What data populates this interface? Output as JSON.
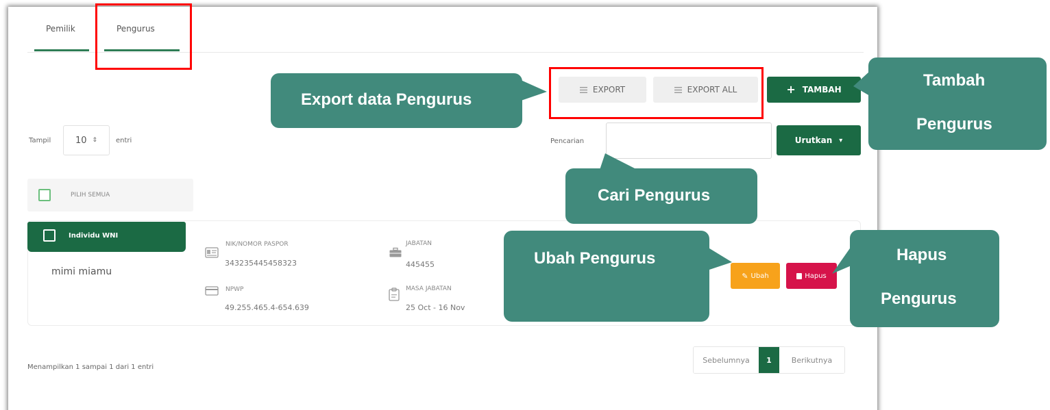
{
  "tabs": [
    {
      "label": "Pemilik"
    },
    {
      "label": "Pengurus"
    }
  ],
  "toolbar": {
    "export_label": "EXPORT",
    "export_all_label": "EXPORT ALL",
    "tambah_label": "TAMBAH",
    "list_icon": "list-icon",
    "plus_icon": "plus-icon"
  },
  "filter": {
    "show_label": "Tampil",
    "show_value": "10",
    "entries_label": "entri",
    "search_label": "Pencarian",
    "search_value": "",
    "sort_label": "Urutkan",
    "sort_icon": "caret-down-icon"
  },
  "select_all": {
    "label": "PILIH SEMUA"
  },
  "record": {
    "type_badge": "Individu WNI",
    "name": "mimi miamu",
    "nik_label": "NIK/NOMOR PASPOR",
    "nik_value": "343235445458323",
    "npwp_label": "NPWP",
    "npwp_value": "49.255.465.4-654.639",
    "jabatan_label": "JABATAN",
    "jabatan_value": "445455",
    "masa_label": "MASA JABATAN",
    "masa_value": "25 Oct - 16 Nov",
    "ubah_label": "Ubah",
    "hapus_label": "Hapus"
  },
  "footer": {
    "info": "Menampilkan 1 sampai 1 dari 1 entri",
    "prev": "Sebelumnya",
    "page": "1",
    "next": "Berikutnya"
  },
  "callouts": {
    "export": "Export data Pengurus",
    "tambah_line1": "Tambah",
    "tambah_line2": "Pengurus",
    "cari": "Cari Pengurus",
    "ubah": "Ubah Pengurus",
    "hapus_line1": "Hapus",
    "hapus_line2": "Pengurus"
  },
  "colors": {
    "primary_green": "#1b6a44",
    "callout_teal": "#418a7c",
    "highlight_red": "#ff0000",
    "ubah_orange": "#f7a21b",
    "hapus_red": "#d6134a"
  }
}
